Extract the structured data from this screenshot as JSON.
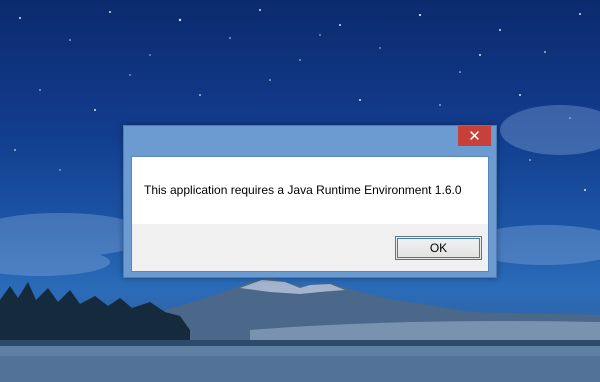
{
  "dialog": {
    "message": "This application requires a Java Runtime Environment 1.6.0",
    "ok_label": "OK",
    "close_glyph": "✕"
  },
  "colors": {
    "frame": "#6b9bd1",
    "close_button": "#c7413a",
    "button_area": "#f0f0f0"
  },
  "icons": [
    "close-icon"
  ]
}
